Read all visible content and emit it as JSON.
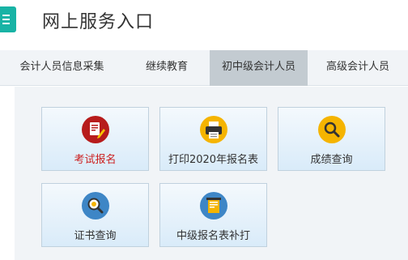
{
  "header": {
    "title": "网上服务入口"
  },
  "tabs": [
    {
      "label": "会计人员信息采集"
    },
    {
      "label": "继续教育"
    },
    {
      "label": "初中级会计人员",
      "active": true
    },
    {
      "label": "高级会计人员"
    }
  ],
  "cards": [
    {
      "label": "考试报名",
      "icon": "exam-registration-icon",
      "color": "#b71c1c",
      "highlight": true
    },
    {
      "label": "打印2020年报名表",
      "icon": "printer-icon",
      "color": "#f5b400"
    },
    {
      "label": "成绩查询",
      "icon": "magnifier-icon",
      "color": "#f5b400"
    },
    {
      "label": "证书查询",
      "icon": "certificate-search-icon",
      "color": "#3e86c6"
    },
    {
      "label": "中级报名表补打",
      "icon": "form-reprint-icon",
      "color": "#3e86c6"
    }
  ],
  "colors": {
    "accent": "#18b3a5",
    "activeTab": "#c3cbd1",
    "highlightText": "#cc1f1f"
  }
}
